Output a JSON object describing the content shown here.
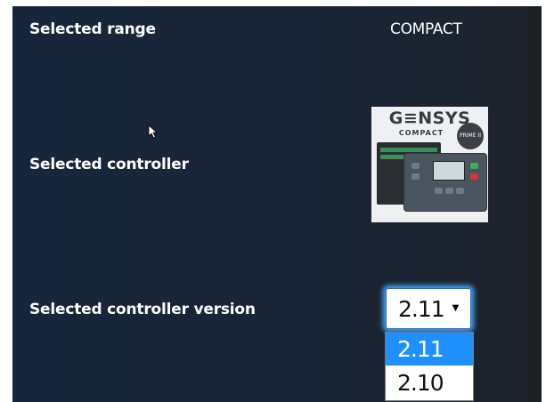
{
  "rows": {
    "range_label": "Selected range",
    "range_value": "COMPACT",
    "controller_label": "Selected controller",
    "version_label": "Selected controller version"
  },
  "product": {
    "brand": "G≡NSYS",
    "subtitle": "COMPACT",
    "badge": "PRIME II"
  },
  "version_select": {
    "selected": "2.11",
    "options": [
      "2.11",
      "2.10"
    ],
    "highlighted_index": 0
  },
  "colors": {
    "panel_bg": "#182536",
    "select_focus": "#49a9ff",
    "option_highlight": "#1e90ff"
  }
}
